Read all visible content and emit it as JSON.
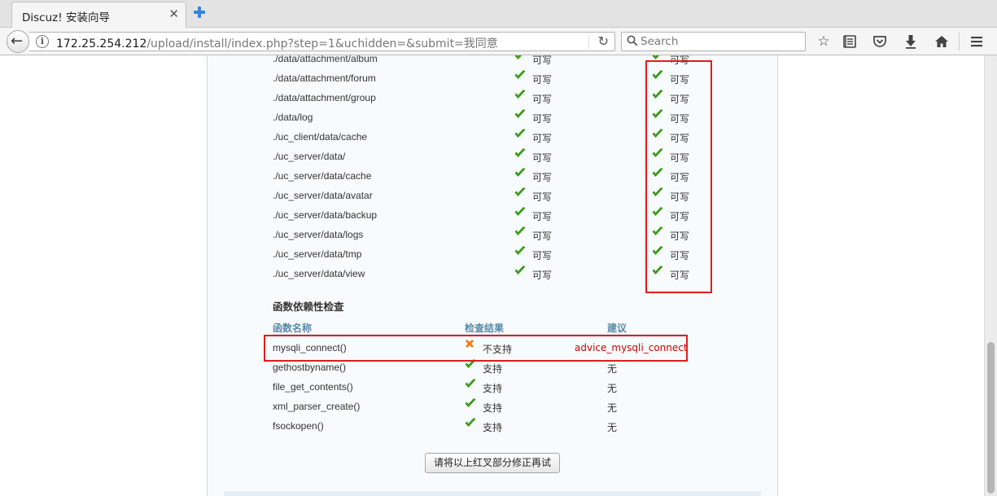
{
  "browser": {
    "tab_title": "Discuz! 安装向导",
    "tab_close": "✕",
    "url_host": "172.25.254.212",
    "url_path": "/upload/install/index.php?step=1&uchidden=&submit=我同意",
    "search_placeholder": "Search"
  },
  "dir_check": {
    "rows": [
      {
        "path": "./data/attachment/album",
        "current": "可写",
        "required": "可写"
      },
      {
        "path": "./data/attachment/forum",
        "current": "可写",
        "required": "可写"
      },
      {
        "path": "./data/attachment/group",
        "current": "可写",
        "required": "可写"
      },
      {
        "path": "./data/log",
        "current": "可写",
        "required": "可写"
      },
      {
        "path": "./uc_client/data/cache",
        "current": "可写",
        "required": "可写"
      },
      {
        "path": "./uc_server/data/",
        "current": "可写",
        "required": "可写"
      },
      {
        "path": "./uc_server/data/cache",
        "current": "可写",
        "required": "可写"
      },
      {
        "path": "./uc_server/data/avatar",
        "current": "可写",
        "required": "可写"
      },
      {
        "path": "./uc_server/data/backup",
        "current": "可写",
        "required": "可写"
      },
      {
        "path": "./uc_server/data/logs",
        "current": "可写",
        "required": "可写"
      },
      {
        "path": "./uc_server/data/tmp",
        "current": "可写",
        "required": "可写"
      },
      {
        "path": "./uc_server/data/view",
        "current": "可写",
        "required": "可写"
      }
    ]
  },
  "func_check": {
    "title": "函数依赖性检查",
    "headers": {
      "name": "函数名称",
      "result": "检查结果",
      "advice": "建议"
    },
    "rows": [
      {
        "name": "mysqli_connect()",
        "result": "不支持",
        "advice": "advice_mysqli_connect",
        "ok": false
      },
      {
        "name": "gethostbyname()",
        "result": "支持",
        "advice": "无",
        "ok": true
      },
      {
        "name": "file_get_contents()",
        "result": "支持",
        "advice": "无",
        "ok": true
      },
      {
        "name": "xml_parser_create()",
        "result": "支持",
        "advice": "无",
        "ok": true
      },
      {
        "name": "fsockopen()",
        "result": "支持",
        "advice": "无",
        "ok": true
      }
    ]
  },
  "retry_button": "请将以上红叉部分修正再试",
  "colors": {
    "ok": "#3da516",
    "fail": "#f07a16",
    "highlight": "#e21c1c",
    "header": "#5889a8"
  }
}
